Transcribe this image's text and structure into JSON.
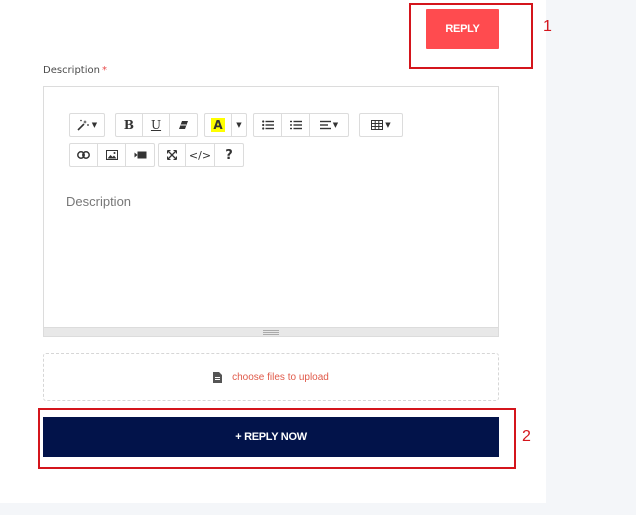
{
  "header": {
    "reply_label": "REPLY"
  },
  "form": {
    "description_label": "Description",
    "required_mark": "*",
    "editor_placeholder": "Description",
    "toolbar": {
      "row1": [
        "magic-icon",
        "bold-icon",
        "underline-icon",
        "eraser-icon",
        "font-color-icon",
        "unordered-list-icon",
        "ordered-list-icon",
        "align-icon",
        "table-icon"
      ],
      "row2": [
        "link-icon",
        "picture-icon",
        "video-icon",
        "fullscreen-icon",
        "code-view-icon",
        "help-icon"
      ],
      "bold_glyph": "B",
      "underline_glyph": "U",
      "font_color_glyph": "A",
      "code_glyph": "</>",
      "help_glyph": "?"
    },
    "upload_text": "choose files to upload",
    "submit_label": "+ REPLY NOW"
  },
  "annotations": {
    "box1": "1",
    "box2": "2"
  },
  "colors": {
    "reply_button": "#ff4b4f",
    "submit_button": "#02134a",
    "annotation": "#d4151c",
    "upload_text": "#e05a4a",
    "highlight": "#ffff00"
  }
}
